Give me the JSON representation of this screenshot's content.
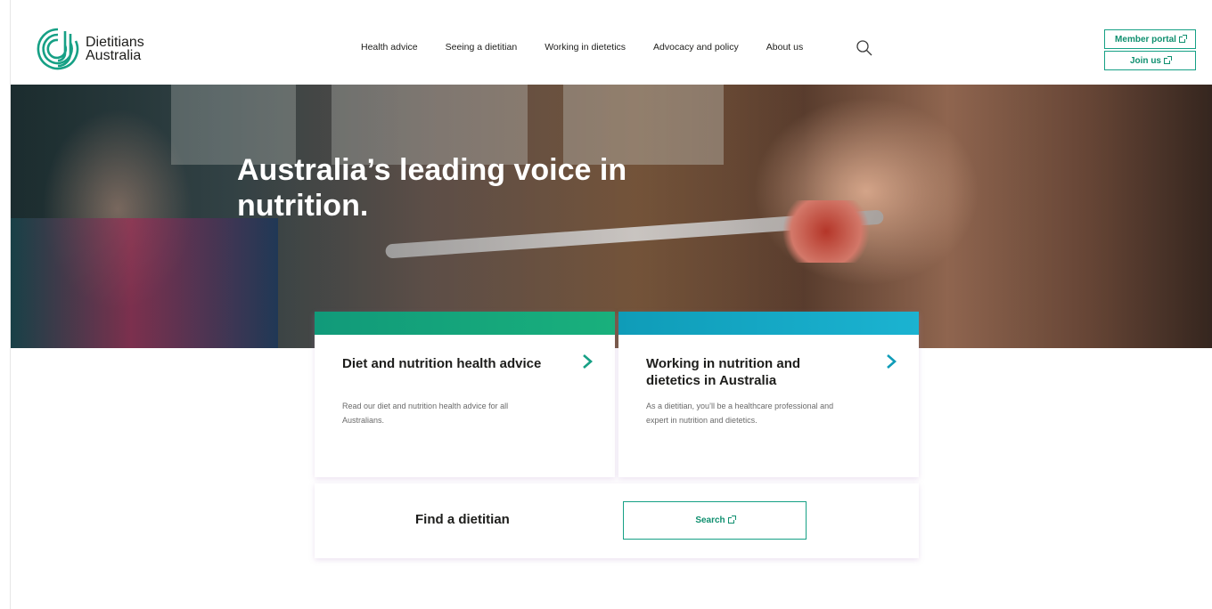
{
  "brand": {
    "name_line1": "Dietitians",
    "name_line2": "Australia",
    "accent": "#16a085"
  },
  "nav": {
    "items": [
      {
        "label": "Health advice"
      },
      {
        "label": "Seeing a dietitian"
      },
      {
        "label": "Working in dietetics"
      },
      {
        "label": "Advocacy and policy"
      },
      {
        "label": "About us"
      }
    ],
    "search_icon": "search-icon"
  },
  "header_buttons": {
    "member_portal": "Member portal",
    "join_us": "Join us"
  },
  "hero": {
    "title": "Australia’s leading voice in nutrition."
  },
  "cards": [
    {
      "title": "Diet and nutrition health advice",
      "description": "Read our diet and nutrition health advice for all Australians.",
      "bar_color": "#119a7a"
    },
    {
      "title": "Working in nutrition and dietetics in Australia",
      "description": "As a dietitian, you’ll be a healthcare professional and expert in nutrition and dietetics.",
      "bar_color": "#0f9cb8"
    }
  ],
  "find": {
    "label": "Find a dietitian",
    "button": "Search"
  }
}
